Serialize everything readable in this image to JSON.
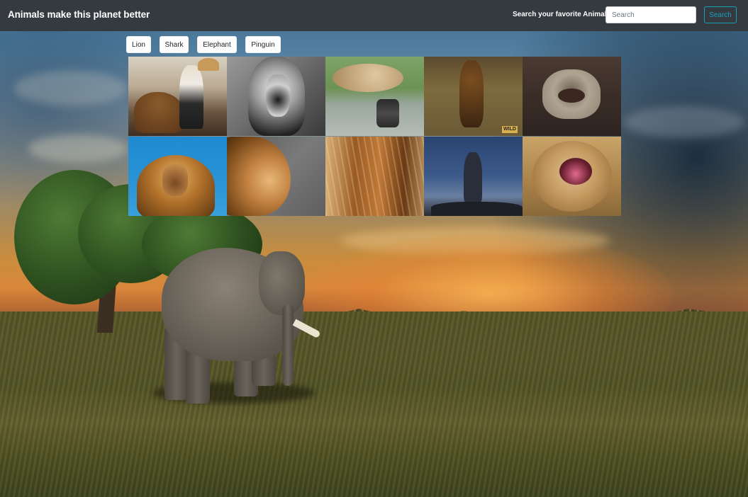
{
  "navbar": {
    "brand": "Animals make this planet better",
    "search_label": "Search your favorite Animals",
    "search_placeholder": "Search",
    "search_value": "",
    "search_button": "Search"
  },
  "categories": [
    "Lion",
    "Shark",
    "Elephant",
    "Pinguin"
  ],
  "gifs": [
    {
      "subject": "lion-with-woman-photo"
    },
    {
      "subject": "lion-black-and-white-photo"
    },
    {
      "subject": "lioness-on-table-photo"
    },
    {
      "subject": "lion-walking-savanna-photo",
      "watermark": "WILD"
    },
    {
      "subject": "kitten-roaring-photo"
    },
    {
      "subject": "lion-blue-sky-photo"
    },
    {
      "subject": "lion-profile-photo"
    },
    {
      "subject": "lion-in-grass-photo"
    },
    {
      "subject": "lion-roaring-night-photo"
    },
    {
      "subject": "lion-yawning-photo"
    }
  ],
  "background": {
    "subject": "elephant-savanna-sunset-photo"
  }
}
